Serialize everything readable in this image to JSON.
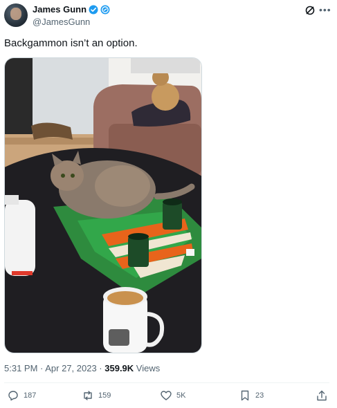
{
  "tweet": {
    "author": {
      "name": "James Gunn",
      "handle": "@JamesGunn"
    },
    "text": "Backgammon isn’t an option.",
    "timestamp": "5:31 PM · Apr 27, 2023 · ",
    "views_count": "359.9K",
    "views_label": " Views",
    "stats": {
      "replies": "187",
      "reposts": "159",
      "likes": "5K",
      "bookmarks": "23"
    }
  },
  "colors": {
    "verified": "#1d9bf0",
    "text": "#0f1419",
    "secondary": "#536471",
    "board_green": "#2e8b3e",
    "board_orange": "#e8641b"
  },
  "icons": [
    "verified-badge-icon",
    "affiliate-badge-icon",
    "grok-icon",
    "more-icon",
    "reply-icon",
    "repost-icon",
    "like-icon",
    "bookmark-icon",
    "share-icon"
  ]
}
